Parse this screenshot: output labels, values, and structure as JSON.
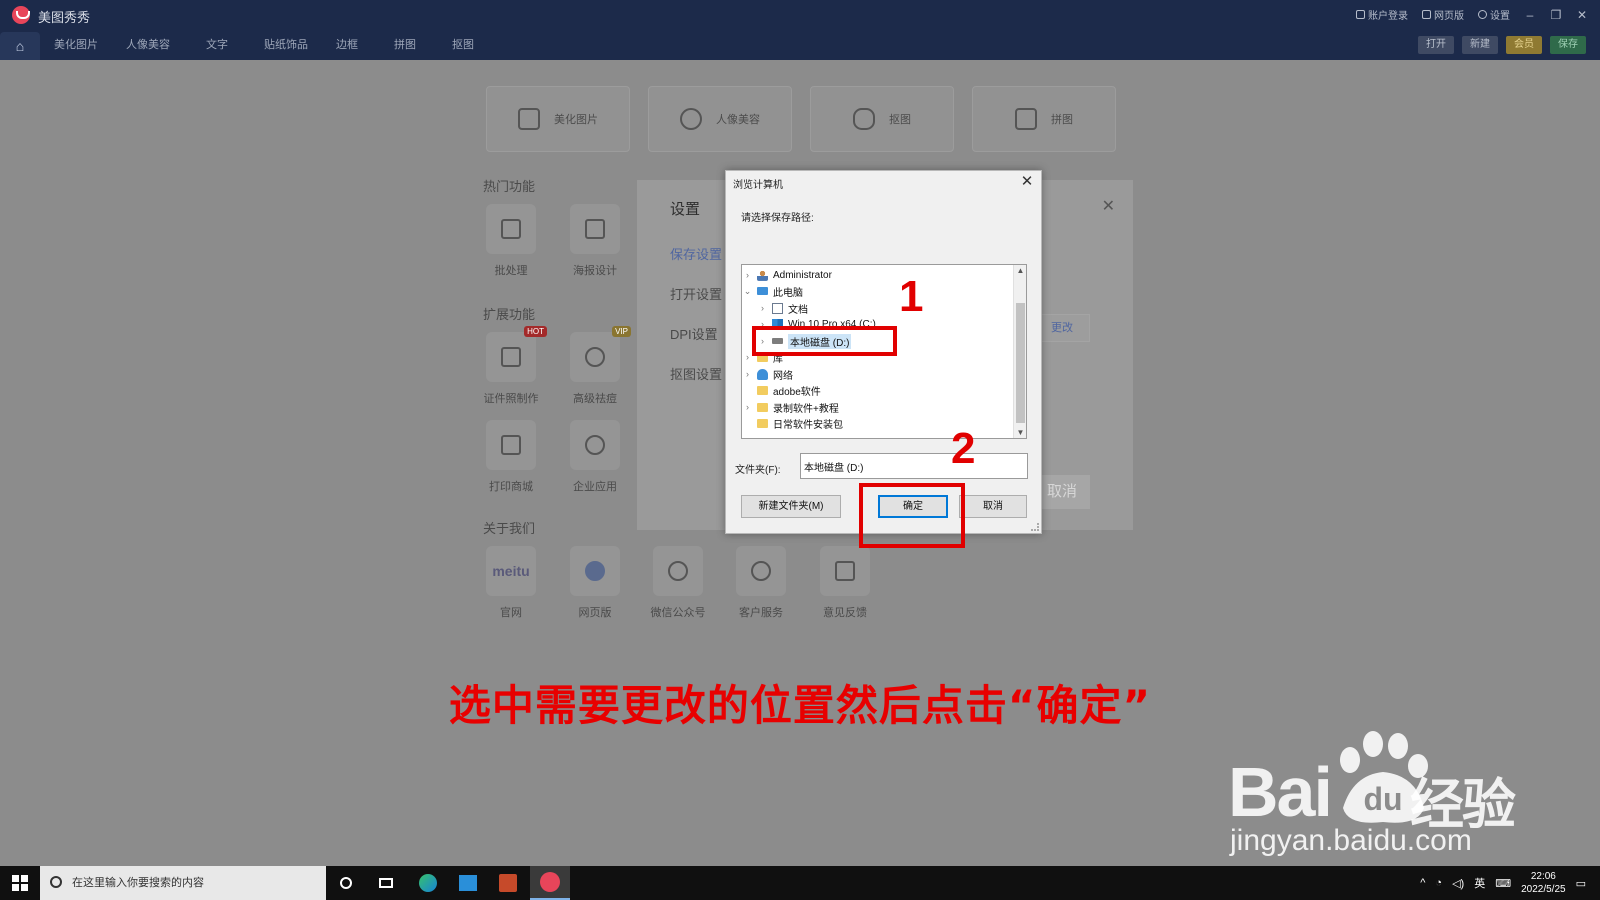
{
  "app": {
    "name": "美图秀秀",
    "top_right": [
      "账户登录",
      "网页版",
      "设置"
    ],
    "nav_tabs": [
      "美化图片",
      "人像美容",
      "文字",
      "贴纸饰品",
      "边框",
      "拼图",
      "抠图"
    ],
    "nav_buttons": [
      "打开",
      "新建",
      "会员",
      "保存"
    ]
  },
  "home": {
    "main_cards": [
      "美化图片",
      "人像美容",
      "抠图",
      "拼图"
    ],
    "hot_title": "热门功能",
    "hot_items": [
      "批处理",
      "海报设计"
    ],
    "ext_title": "扩展功能",
    "ext_items": [
      "证件照制作",
      "高级祛痘",
      "打印商城",
      "企业应用"
    ],
    "badges": {
      "hot": "HOT",
      "vip": "VIP"
    },
    "about_title": "关于我们",
    "about_items": [
      "官网",
      "网页版",
      "微信公众号",
      "客户服务",
      "意见反馈"
    ],
    "meitu_logo_text": "meitu"
  },
  "settings": {
    "title": "设置",
    "menu": [
      "保存设置",
      "打开设置",
      "DPI设置",
      "抠图设置"
    ],
    "change_label": "更改",
    "cancel_label": "取消"
  },
  "dialog": {
    "title": "浏览计算机",
    "prompt": "请选择保存路径:",
    "tree": [
      {
        "label": "Administrator",
        "icon": "user-icon",
        "chevron": "›"
      },
      {
        "label": "此电脑",
        "icon": "computer-icon",
        "chevron": "⌄"
      },
      {
        "label": "文档",
        "icon": "document-icon",
        "chevron": "›"
      },
      {
        "label": "Win 10 Pro x64 (C:)",
        "icon": "windows-drive-icon",
        "chevron": "›"
      },
      {
        "label": "本地磁盘 (D:)",
        "icon": "disk-icon",
        "chevron": "›"
      },
      {
        "label": "库",
        "icon": "library-icon",
        "chevron": "›"
      },
      {
        "label": "网络",
        "icon": "network-icon",
        "chevron": "›"
      },
      {
        "label": "adobe软件",
        "icon": "folder-icon",
        "chevron": ""
      },
      {
        "label": "录制软件+教程",
        "icon": "folder-icon",
        "chevron": "›"
      },
      {
        "label": "日常软件安装包",
        "icon": "folder-icon",
        "chevron": ""
      }
    ],
    "folder_label": "文件夹(F):",
    "folder_value": "本地磁盘 (D:)",
    "new_folder_label": "新建文件夹(M)",
    "ok_label": "确定",
    "cancel_label": "取消"
  },
  "annotations": {
    "step1": "1",
    "step2": "2",
    "caption": "选中需要更改的位置然后点击“确定”",
    "color": "#e10000"
  },
  "watermark": {
    "brand": "Bai",
    "paw_text": "du",
    "cn": "经验",
    "url": "jingyan.baidu.com"
  },
  "taskbar": {
    "search_placeholder": "在这里输入你要搜索的内容",
    "ime": "英",
    "time": "22:06",
    "date": "2022/5/25"
  }
}
